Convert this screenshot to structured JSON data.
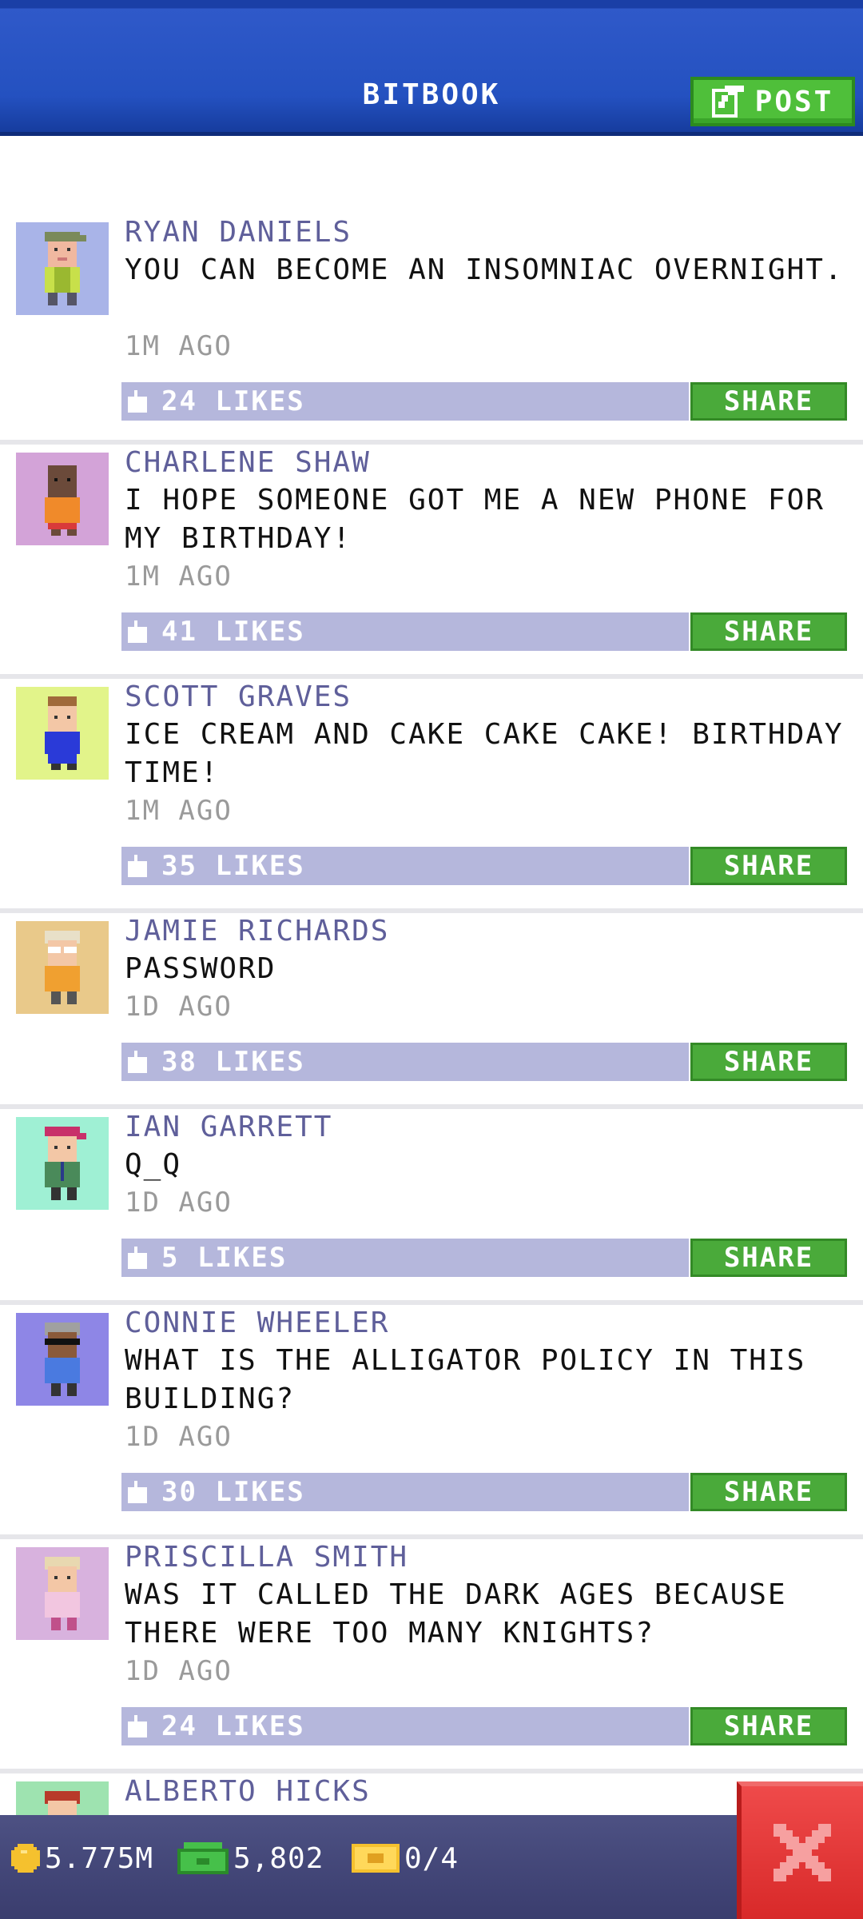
{
  "header": {
    "title": "BITBOOK",
    "post_label": "POST"
  },
  "colors": {
    "header_blue": "#2451c0",
    "accent_green": "#4fbf3a",
    "like_bar": "#b5b7dc",
    "name_purple": "#5f5f9a",
    "close_red": "#e23b3b"
  },
  "posts": [
    {
      "author": "RYAN DANIELS",
      "message": "YOU CAN BECOME AN INSOMNIAC OVERNIGHT.",
      "time": "1M AGO",
      "likes": "24 LIKES",
      "share_label": "SHARE",
      "avatar_bg": "#a9b4e8",
      "avatar_icon": "person-green-cap-avatar"
    },
    {
      "author": "CHARLENE SHAW",
      "message": "I HOPE SOMEONE GOT ME A NEW PHONE FOR MY BIRTHDAY!",
      "time": "1M AGO",
      "likes": "41 LIKES",
      "share_label": "SHARE",
      "avatar_bg": "#d3a3d8",
      "avatar_icon": "person-dark-skin-avatar"
    },
    {
      "author": "SCOTT GRAVES",
      "message": "ICE CREAM AND CAKE CAKE CAKE! BIRTHDAY TIME!",
      "time": "1M AGO",
      "likes": "35 LIKES",
      "share_label": "SHARE",
      "avatar_bg": "#e2f48a",
      "avatar_icon": "person-blue-shirt-avatar"
    },
    {
      "author": "JAMIE RICHARDS",
      "message": "PASSWORD",
      "time": "1D AGO",
      "likes": "38 LIKES",
      "share_label": "SHARE",
      "avatar_bg": "#e9c98a",
      "avatar_icon": "person-glasses-avatar"
    },
    {
      "author": "IAN GARRETT",
      "message": "Q_Q",
      "time": "1D AGO",
      "likes": "5 LIKES",
      "share_label": "SHARE",
      "avatar_bg": "#9ff0d4",
      "avatar_icon": "person-pink-cap-avatar"
    },
    {
      "author": "CONNIE WHEELER",
      "message": "WHAT IS THE ALLIGATOR POLICY IN THIS BUILDING?",
      "time": "1D AGO",
      "likes": "30 LIKES",
      "share_label": "SHARE",
      "avatar_bg": "#8e86e6",
      "avatar_icon": "person-sunglasses-avatar"
    },
    {
      "author": "PRISCILLA SMITH",
      "message": "WAS IT CALLED THE DARK AGES BECAUSE THERE WERE TOO MANY KNIGHTS?",
      "time": "1D AGO",
      "likes": "24 LIKES",
      "share_label": "SHARE",
      "avatar_bg": "#d8b2de",
      "avatar_icon": "person-pink-shirt-avatar"
    },
    {
      "author": "ALBERTO HICKS",
      "avatar_bg": "#9ee3b0",
      "avatar_icon": "person-red-hair-avatar"
    }
  ],
  "status_bar": {
    "coins": "5.775M",
    "bux": "5,802",
    "tickets": "0/4"
  }
}
